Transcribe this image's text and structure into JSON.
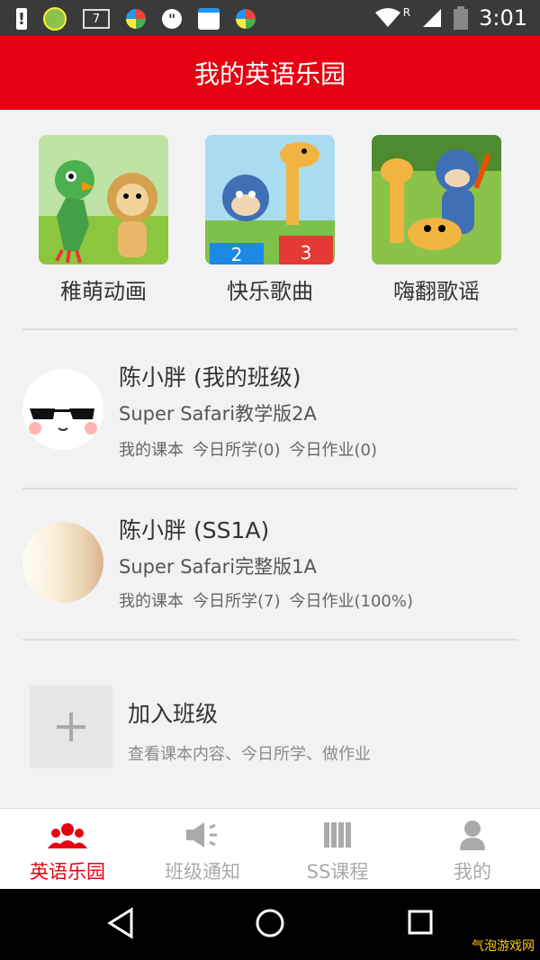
{
  "status_bar": {
    "time": "3:01",
    "icons": [
      "alert-icon",
      "app-icon",
      "notification-7-icon",
      "app-icon",
      "quote-icon",
      "calendar-icon",
      "app-icon",
      "wifi-icon",
      "signal-icon",
      "battery-icon"
    ],
    "notification_count": "7",
    "roaming_label": "R"
  },
  "header": {
    "title": "我的英语乐园"
  },
  "categories": [
    {
      "label": "稚萌动画"
    },
    {
      "label": "快乐歌曲"
    },
    {
      "label": "嗨翻歌谣"
    }
  ],
  "classes": [
    {
      "name": "陈小胖 (我的班级)",
      "course": "Super Safari教学版2A",
      "stats": {
        "lessons": "我的课本",
        "today_learned": "今日所学(0)",
        "today_homework": "今日作业(0)"
      }
    },
    {
      "name": "陈小胖 (SS1A)",
      "course": "Super Safari完整版1A",
      "stats": {
        "lessons": "我的课本",
        "today_learned": "今日所学(7)",
        "today_homework": "今日作业(100%)"
      }
    }
  ],
  "join": {
    "title": "加入班级",
    "desc": "查看课本内容、今日所学、做作业"
  },
  "tabs": [
    {
      "label": "英语乐园",
      "icon": "group-icon",
      "active": true
    },
    {
      "label": "班级通知",
      "icon": "speaker-icon",
      "active": false
    },
    {
      "label": "SS课程",
      "icon": "books-icon",
      "active": false
    },
    {
      "label": "我的",
      "icon": "person-icon",
      "active": false
    }
  ],
  "watermark": "气泡游戏网",
  "colors": {
    "accent": "#e60012",
    "tab_inactive": "#aaaaaa",
    "background": "#f2f2f2"
  }
}
